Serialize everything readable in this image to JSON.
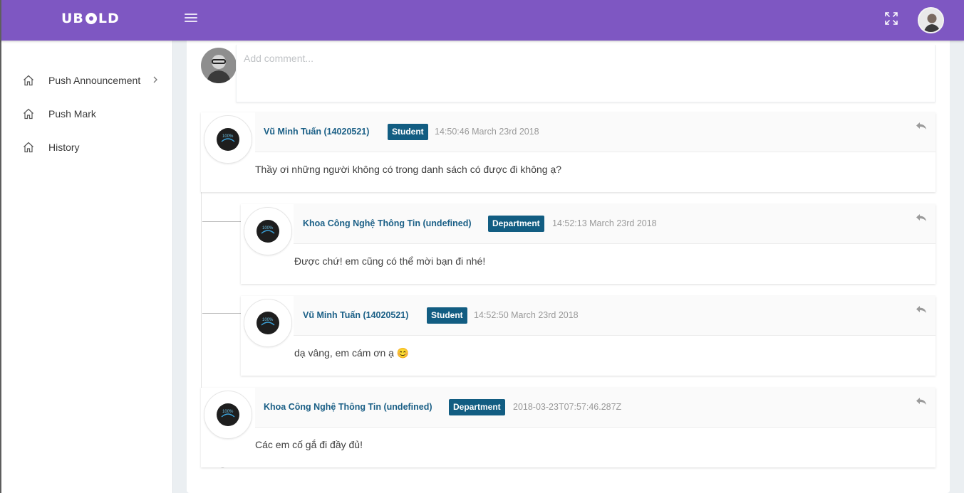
{
  "app": {
    "logo_left": "UB",
    "logo_right": "LD"
  },
  "topbar": {
    "menu_icon": "hamburger-icon",
    "fullscreen_icon": "fullscreen-icon",
    "avatar_icon": "user-avatar"
  },
  "sidebar": {
    "items": [
      {
        "label": "Push Announcement",
        "icon": "home-icon",
        "has_submenu": true
      },
      {
        "label": "Push Mark",
        "icon": "home-icon"
      },
      {
        "label": "History",
        "icon": "home-icon"
      }
    ]
  },
  "composer": {
    "placeholder": "Add comment..."
  },
  "comments": [
    {
      "author": "Vũ Minh Tuấn (14020521)",
      "role": "Student",
      "time": "14:50:46 March 23rd 2018",
      "text": "Thầy ơi những người không có trong danh sách có được đi không ạ?"
    },
    {
      "author": "Khoa Công Nghệ Thông Tin (undefined)",
      "role": "Department",
      "time": "14:52:13 March 23rd 2018",
      "text": "Được chứ! em cũng có thể mời bạn đi nhé!"
    },
    {
      "author": "Vũ Minh Tuấn (14020521)",
      "role": "Student",
      "time": "14:52:50 March 23rd 2018",
      "text": "dạ vâng, em cám ơn ạ 😊"
    },
    {
      "author": "Khoa Công Nghệ Thông Tin (undefined)",
      "role": "Department",
      "time": "2018-03-23T07:57:46.287Z",
      "text": "Các em cố gắ đi đầy đủ!"
    }
  ],
  "colors": {
    "topbar": "#7e57c2",
    "badge": "#125d82",
    "author": "#1a5f86"
  }
}
